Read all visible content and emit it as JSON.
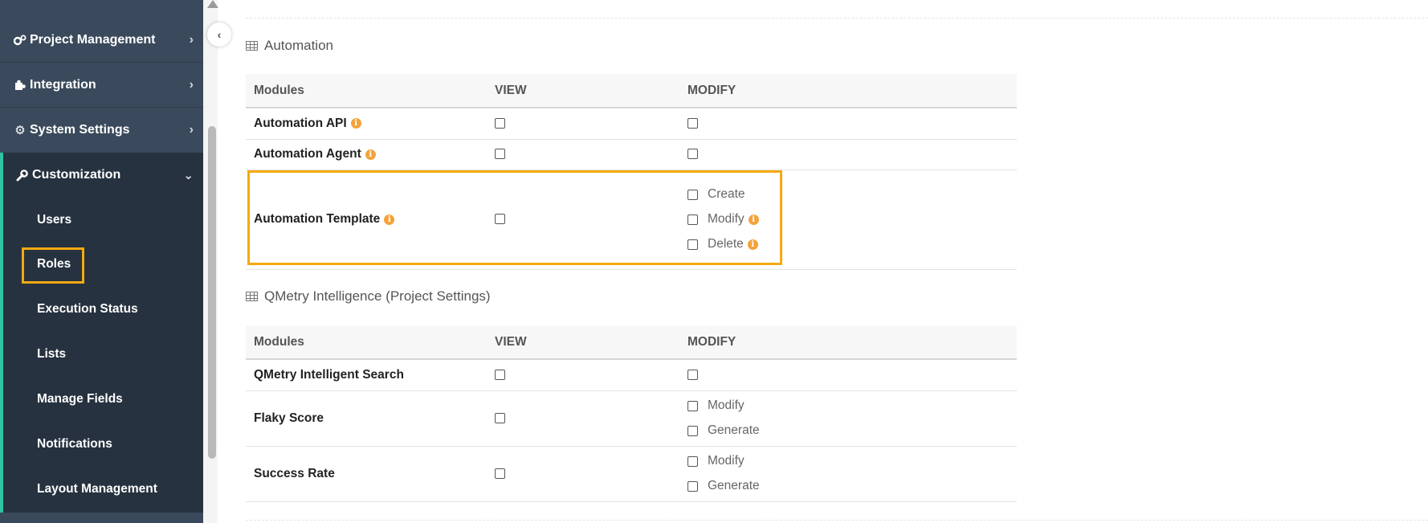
{
  "sidebar": {
    "nav": [
      {
        "label": "Project Management",
        "icon": "cogs-icon"
      },
      {
        "label": "Integration",
        "icon": "puzzle-icon"
      },
      {
        "label": "System Settings",
        "icon": "gear-icon"
      }
    ],
    "active_group": {
      "label": "Customization",
      "icon": "wrench-icon"
    },
    "sub_items": [
      {
        "label": "Users"
      },
      {
        "label": "Roles"
      },
      {
        "label": "Execution Status"
      },
      {
        "label": "Lists"
      },
      {
        "label": "Manage Fields"
      },
      {
        "label": "Notifications"
      },
      {
        "label": "Layout Management"
      }
    ],
    "selected_item": "Roles"
  },
  "colors": {
    "sidebar_bg": "#3a4a5c",
    "sub_panel_bg": "#26323f",
    "accent": "#2ec4a4",
    "highlight": "#f5a911",
    "info_icon": "#f3a33c"
  },
  "sections": [
    {
      "title": "Automation",
      "headers": {
        "modules": "Modules",
        "view": "VIEW",
        "modify": "MODIFY"
      },
      "rows": [
        {
          "name": "Automation API",
          "info": true,
          "view_checked": false,
          "modify_checked": false
        },
        {
          "name": "Automation Agent",
          "info": true,
          "view_checked": false,
          "modify_checked": false
        },
        {
          "name": "Automation Template",
          "info": true,
          "view_checked": false,
          "modify_options": [
            {
              "label": "Create",
              "info": false
            },
            {
              "label": "Modify",
              "info": true
            },
            {
              "label": "Delete",
              "info": true
            }
          ]
        }
      ]
    },
    {
      "title": "QMetry Intelligence (Project Settings)",
      "headers": {
        "modules": "Modules",
        "view": "VIEW",
        "modify": "MODIFY"
      },
      "rows": [
        {
          "name": "QMetry Intelligent Search",
          "view_checked": false,
          "modify_checked": false
        },
        {
          "name": "Flaky Score",
          "view_checked": false,
          "modify_options": [
            {
              "label": "Modify"
            },
            {
              "label": "Generate"
            }
          ]
        },
        {
          "name": "Success Rate",
          "view_checked": false,
          "modify_options": [
            {
              "label": "Modify"
            },
            {
              "label": "Generate"
            }
          ]
        }
      ]
    }
  ]
}
